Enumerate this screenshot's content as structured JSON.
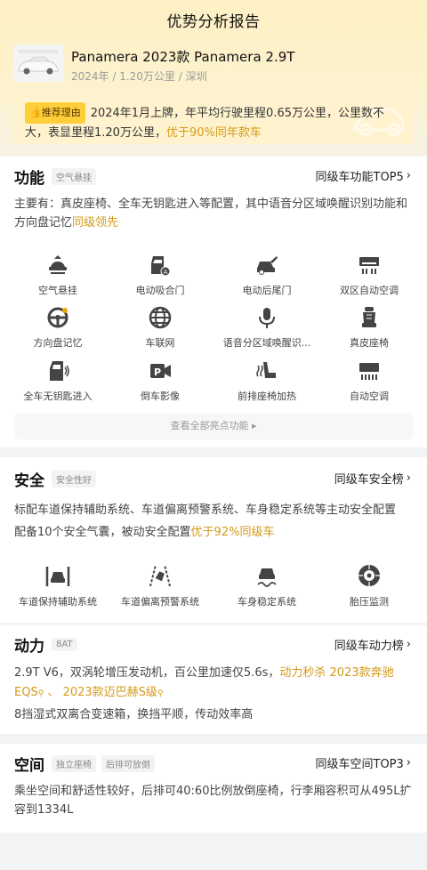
{
  "header": {
    "title": "优势分析报告"
  },
  "car": {
    "name": "Panamera 2023款 Panamera 2.9T",
    "meta": "2024年 / 1.20万公里 / 深圳"
  },
  "recommend": {
    "tag": "推荐理由",
    "text": "2024年1月上牌，年平均行驶里程0.65万公里，公里数不大，表显里程1.20万公里，",
    "highlight": "优于90%同年款车"
  },
  "function_section": {
    "title": "功能",
    "chip": "空气悬挂",
    "link": "同级车功能TOP5",
    "desc": "主要有：真皮座椅、全车无钥匙进入等配置，其中语音分区域唤醒识别功能和方向盘记忆",
    "desc_highlight": "同级领先",
    "features": [
      {
        "label": "空气悬挂",
        "icon": "air-suspension-icon"
      },
      {
        "label": "电动吸合门",
        "icon": "soft-close-door-icon"
      },
      {
        "label": "电动后尾门",
        "icon": "power-tailgate-icon"
      },
      {
        "label": "双区自动空调",
        "icon": "dual-zone-ac-icon"
      },
      {
        "label": "方向盘记忆",
        "icon": "steering-memory-icon"
      },
      {
        "label": "车联网",
        "icon": "connected-car-icon"
      },
      {
        "label": "语音分区域唤醒识...",
        "icon": "voice-wake-icon"
      },
      {
        "label": "真皮座椅",
        "icon": "leather-seat-icon"
      },
      {
        "label": "全车无钥匙进入",
        "icon": "keyless-entry-icon"
      },
      {
        "label": "倒车影像",
        "icon": "reverse-camera-icon"
      },
      {
        "label": "前排座椅加热",
        "icon": "seat-heating-icon"
      },
      {
        "label": "自动空调",
        "icon": "auto-ac-icon"
      }
    ],
    "view_all": "查看全部亮点功能"
  },
  "safety_section": {
    "title": "安全",
    "chip": "安全性好",
    "link": "同级车安全榜",
    "desc_line1": "标配车道保持辅助系统、车道偏离预警系统、车身稳定系统等主动安全配置",
    "desc_line2": "配备10个安全气囊，被动安全配置",
    "desc_highlight": "优于92%同级车",
    "features": [
      {
        "label": "车道保持辅助系统",
        "icon": "lane-keeping-icon"
      },
      {
        "label": "车道偏离预警系统",
        "icon": "lane-departure-icon"
      },
      {
        "label": "车身稳定系统",
        "icon": "stability-control-icon"
      },
      {
        "label": "胎压监测",
        "icon": "tire-pressure-icon"
      }
    ]
  },
  "power_section": {
    "title": "动力",
    "chip": "8AT",
    "link": "同级车动力榜",
    "desc": "2.9T V6，双涡轮增压发动机，百公里加速仅5.6s，",
    "highlight": "动力秒杀",
    "rival1": "2023款奔驰EQS",
    "separator": "、",
    "rival2": "2023款迈巴赫S级",
    "desc2": "8挡湿式双离合变速箱，换挡平顺，传动效率高"
  },
  "space_section": {
    "title": "空间",
    "chips": [
      "独立座椅",
      "后排可放倒"
    ],
    "link": "同级车空间TOP3",
    "desc": "乘坐空间和舒适性较好，后排可40:60比例放倒座椅，行李厢容积可从495L扩容到1334L"
  },
  "colors": {
    "accent": "#d49a18",
    "tag_bg": "#ffcf3a",
    "header_bg": "#fdf0c4"
  }
}
